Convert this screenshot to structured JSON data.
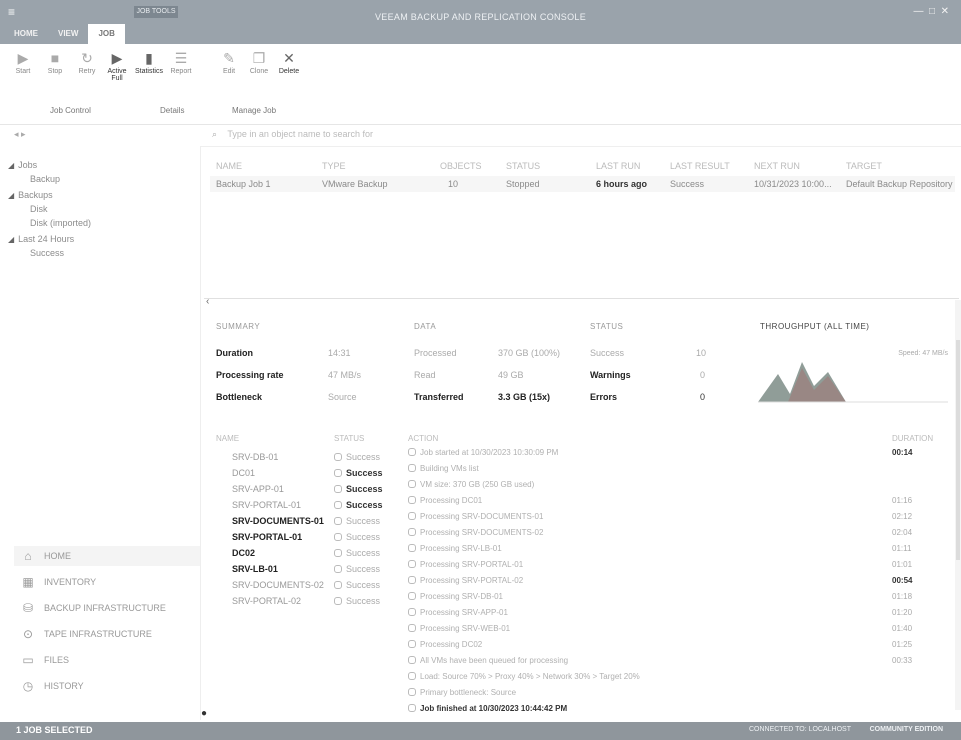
{
  "window": {
    "title": "VEEAM BACKUP AND REPLICATION CONSOLE"
  },
  "tabs": [
    "HOME",
    "VIEW",
    "JOB"
  ],
  "context_tab": "JOB TOOLS",
  "ribbon": {
    "buttons": [
      {
        "label": "Start",
        "icon": "play-icon",
        "enabled": false
      },
      {
        "label": "Stop",
        "icon": "stop-icon",
        "enabled": false
      },
      {
        "label": "Retry",
        "icon": "retry-icon",
        "enabled": false
      },
      {
        "label": "Active Full",
        "icon": "active-full-icon",
        "enabled": true
      },
      {
        "label": "Statistics",
        "icon": "statistics-icon",
        "enabled": true
      },
      {
        "label": "Report",
        "icon": "report-icon",
        "enabled": false
      },
      {
        "label": "Edit",
        "icon": "edit-icon",
        "enabled": false
      },
      {
        "label": "Clone",
        "icon": "clone-icon",
        "enabled": false
      },
      {
        "label": "Delete",
        "icon": "delete-icon",
        "enabled": true
      }
    ],
    "groups": [
      "Job Control",
      "Details",
      "Manage Job"
    ]
  },
  "navigation": {
    "search_placeholder": "Type in an object name to search for",
    "tree": [
      {
        "label": "Jobs",
        "level": 0
      },
      {
        "label": "Backup",
        "level": 1
      },
      {
        "label": "Backups",
        "level": 0
      },
      {
        "label": "Disk",
        "level": 1
      },
      {
        "label": "Disk (imported)",
        "level": 1
      },
      {
        "label": "Last 24 Hours",
        "level": 0
      },
      {
        "label": "Success",
        "level": 1
      }
    ],
    "bottom": [
      {
        "label": "HOME",
        "icon": "home-icon",
        "selected": true
      },
      {
        "label": "INVENTORY",
        "icon": "inventory-icon"
      },
      {
        "label": "BACKUP INFRASTRUCTURE",
        "icon": "backup-infrastructure-icon"
      },
      {
        "label": "TAPE INFRASTRUCTURE",
        "icon": "tape-infrastructure-icon"
      },
      {
        "label": "FILES",
        "icon": "files-icon"
      },
      {
        "label": "HISTORY",
        "icon": "history-icon"
      }
    ]
  },
  "job_grid": {
    "headers": [
      "NAME",
      "TYPE",
      "OBJECTS",
      "STATUS",
      "LAST RUN",
      "LAST RESULT",
      "NEXT RUN",
      "TARGET"
    ],
    "rows": [
      [
        "Backup Job 1",
        "VMware Backup",
        "10",
        "Stopped",
        "6 hours ago",
        "Success",
        "10/31/2023 10:00...",
        "Default Backup Repository"
      ]
    ]
  },
  "summary": {
    "header": "SUMMARY",
    "rows": [
      {
        "label": "Duration",
        "value": "14:31"
      },
      {
        "label": "Processing rate",
        "value": "47 MB/s"
      },
      {
        "label": "Bottleneck",
        "value": "Source"
      }
    ]
  },
  "data": {
    "header": "DATA",
    "rows": [
      {
        "label": "Processed",
        "value": "370 GB (100%)"
      },
      {
        "label": "Read",
        "value": "49 GB"
      },
      {
        "label": "Transferred",
        "value": "3.3 GB (15x)"
      }
    ]
  },
  "status": {
    "header": "STATUS",
    "rows": [
      {
        "label": "Success",
        "value": "10"
      },
      {
        "label": "Warnings",
        "value": "0"
      },
      {
        "label": "Errors",
        "value": "0"
      }
    ]
  },
  "throughput": {
    "header": "THROUGHPUT (ALL TIME)",
    "speed_label": "Speed: 47 MB/s"
  },
  "log": {
    "headers": [
      "NAME",
      "STATUS",
      "ACTION",
      "DURATION"
    ],
    "objects": [
      {
        "name": "SRV-DB-01",
        "status": "Success"
      },
      {
        "name": "DC01",
        "status": "Success"
      },
      {
        "name": "SRV-APP-01",
        "status": "Success"
      },
      {
        "name": "SRV-PORTAL-01",
        "status": "Success"
      },
      {
        "name": "SRV-DOCUMENTS-01",
        "status": "Success"
      },
      {
        "name": "SRV-PORTAL-01",
        "status": "Success"
      },
      {
        "name": "DC02",
        "status": "Success"
      },
      {
        "name": "SRV-LB-01",
        "status": "Success"
      },
      {
        "name": "SRV-DOCUMENTS-02",
        "status": "Success"
      },
      {
        "name": "SRV-PORTAL-02",
        "status": "Success"
      }
    ],
    "actions": [
      {
        "text": "Job started at 10/30/2023 10:30:09 PM",
        "duration": "00:14"
      },
      {
        "text": "Building VMs list",
        "duration": ""
      },
      {
        "text": "VM size: 370 GB (250 GB used)",
        "duration": ""
      },
      {
        "text": "Processing DC01",
        "duration": "01:16"
      },
      {
        "text": "Processing SRV-DOCUMENTS-01",
        "duration": "02:12"
      },
      {
        "text": "Processing SRV-DOCUMENTS-02",
        "duration": "02:04"
      },
      {
        "text": "Processing SRV-LB-01",
        "duration": "01:11"
      },
      {
        "text": "Processing SRV-PORTAL-01",
        "duration": "01:01"
      },
      {
        "text": "Processing SRV-PORTAL-02",
        "duration": "00:54"
      },
      {
        "text": "Processing SRV-DB-01",
        "duration": "01:18"
      },
      {
        "text": "Processing SRV-APP-01",
        "duration": "01:20"
      },
      {
        "text": "Processing SRV-WEB-01",
        "duration": "01:40"
      },
      {
        "text": "Processing DC02",
        "duration": "01:25"
      },
      {
        "text": "All VMs have been queued for processing",
        "duration": "00:33"
      },
      {
        "text": "Load: Source 70% > Proxy 40% > Network 30% > Target 20%",
        "duration": ""
      },
      {
        "text": "Primary bottleneck: Source",
        "duration": ""
      },
      {
        "text": "Job finished at 10/30/2023 10:44:42 PM",
        "duration": ""
      }
    ]
  },
  "statusbar": {
    "left": "1 JOB SELECTED",
    "right": "CONNECTED TO: LOCALHOST",
    "right2": "COMMUNITY EDITION"
  }
}
